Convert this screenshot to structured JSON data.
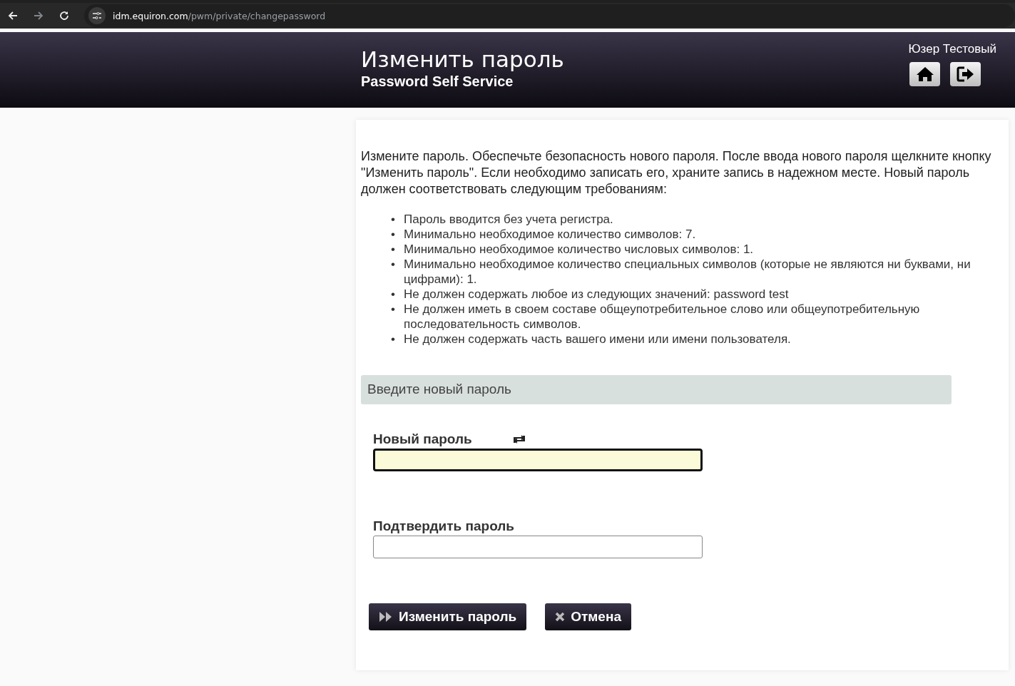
{
  "browser": {
    "url_host": "idm.equiron.com",
    "url_path": "/pwm/private/changepassword"
  },
  "header": {
    "title": "Изменить пароль",
    "subtitle": "Password Self Service",
    "user": "Юзер Тестовый"
  },
  "intro": "Измените пароль. Обеспечьте безопасность нового пароля. После ввода нового пароля щелкните кнопку \"Изменить пароль\". Если необходимо записать его, храните запись в надежном месте. Новый пароль должен соответствовать следующим требованиям:",
  "requirements": [
    {
      "marker": "•",
      "text": "Пароль вводится без учета регистра."
    },
    {
      "marker": "•",
      "text": "Минимально необходимое количество символов: 7."
    },
    {
      "marker": "•",
      "text": "Минимально необходимое количество числовых символов: 1."
    },
    {
      "marker": "•",
      "text": "Минимально необходимое количество специальных символов (которые не являются ни буквами, ни цифрами): 1."
    },
    {
      "marker": "•",
      "text": "Не должен содержать любое из следующих значений: password test"
    },
    {
      "marker": "•",
      "text": "Не должен иметь в своем составе общеупотребительное слово или общеупотребительную последовательность символов."
    },
    {
      "marker": "•",
      "text": "Не должен содержать часть вашего имени или имени пользователя."
    }
  ],
  "section_title": "Введите новый пароль",
  "fields": [
    {
      "label": "Новый пароль",
      "focused": true,
      "has_generate_icon": true
    },
    {
      "label": "Подтвердить пароль",
      "focused": false,
      "has_generate_icon": false
    }
  ],
  "buttons": [
    {
      "kind": "submit",
      "label": "Изменить пароль"
    },
    {
      "kind": "cancel",
      "label": "Отмена"
    }
  ]
}
